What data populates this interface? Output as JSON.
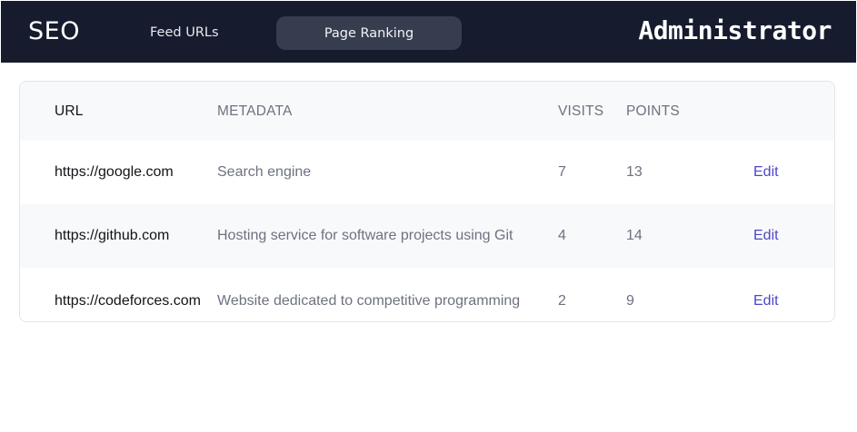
{
  "nav": {
    "logo": "SEO",
    "links": [
      {
        "label": "Feed URLs",
        "active": false
      },
      {
        "label": "Page Ranking",
        "active": true
      }
    ],
    "user_title": "Administrator"
  },
  "table": {
    "headers": {
      "url": "URL",
      "metadata": "METADATA",
      "visits": "VISITS",
      "points": "POINTS"
    },
    "rows": [
      {
        "url": "https://google.com",
        "metadata": "Search engine",
        "visits": "7",
        "points": "13",
        "action": "Edit"
      },
      {
        "url": "https://github.com",
        "metadata": "Hosting service for software projects using Git",
        "visits": "4",
        "points": "14",
        "action": "Edit"
      },
      {
        "url": "https://codeforces.com",
        "metadata": "Website dedicated to competitive programming",
        "visits": "2",
        "points": "9",
        "action": "Edit"
      }
    ]
  },
  "colors": {
    "navbar_bg": "#161c2e",
    "active_pill": "#363d4f",
    "link_accent": "#4f46c8"
  }
}
